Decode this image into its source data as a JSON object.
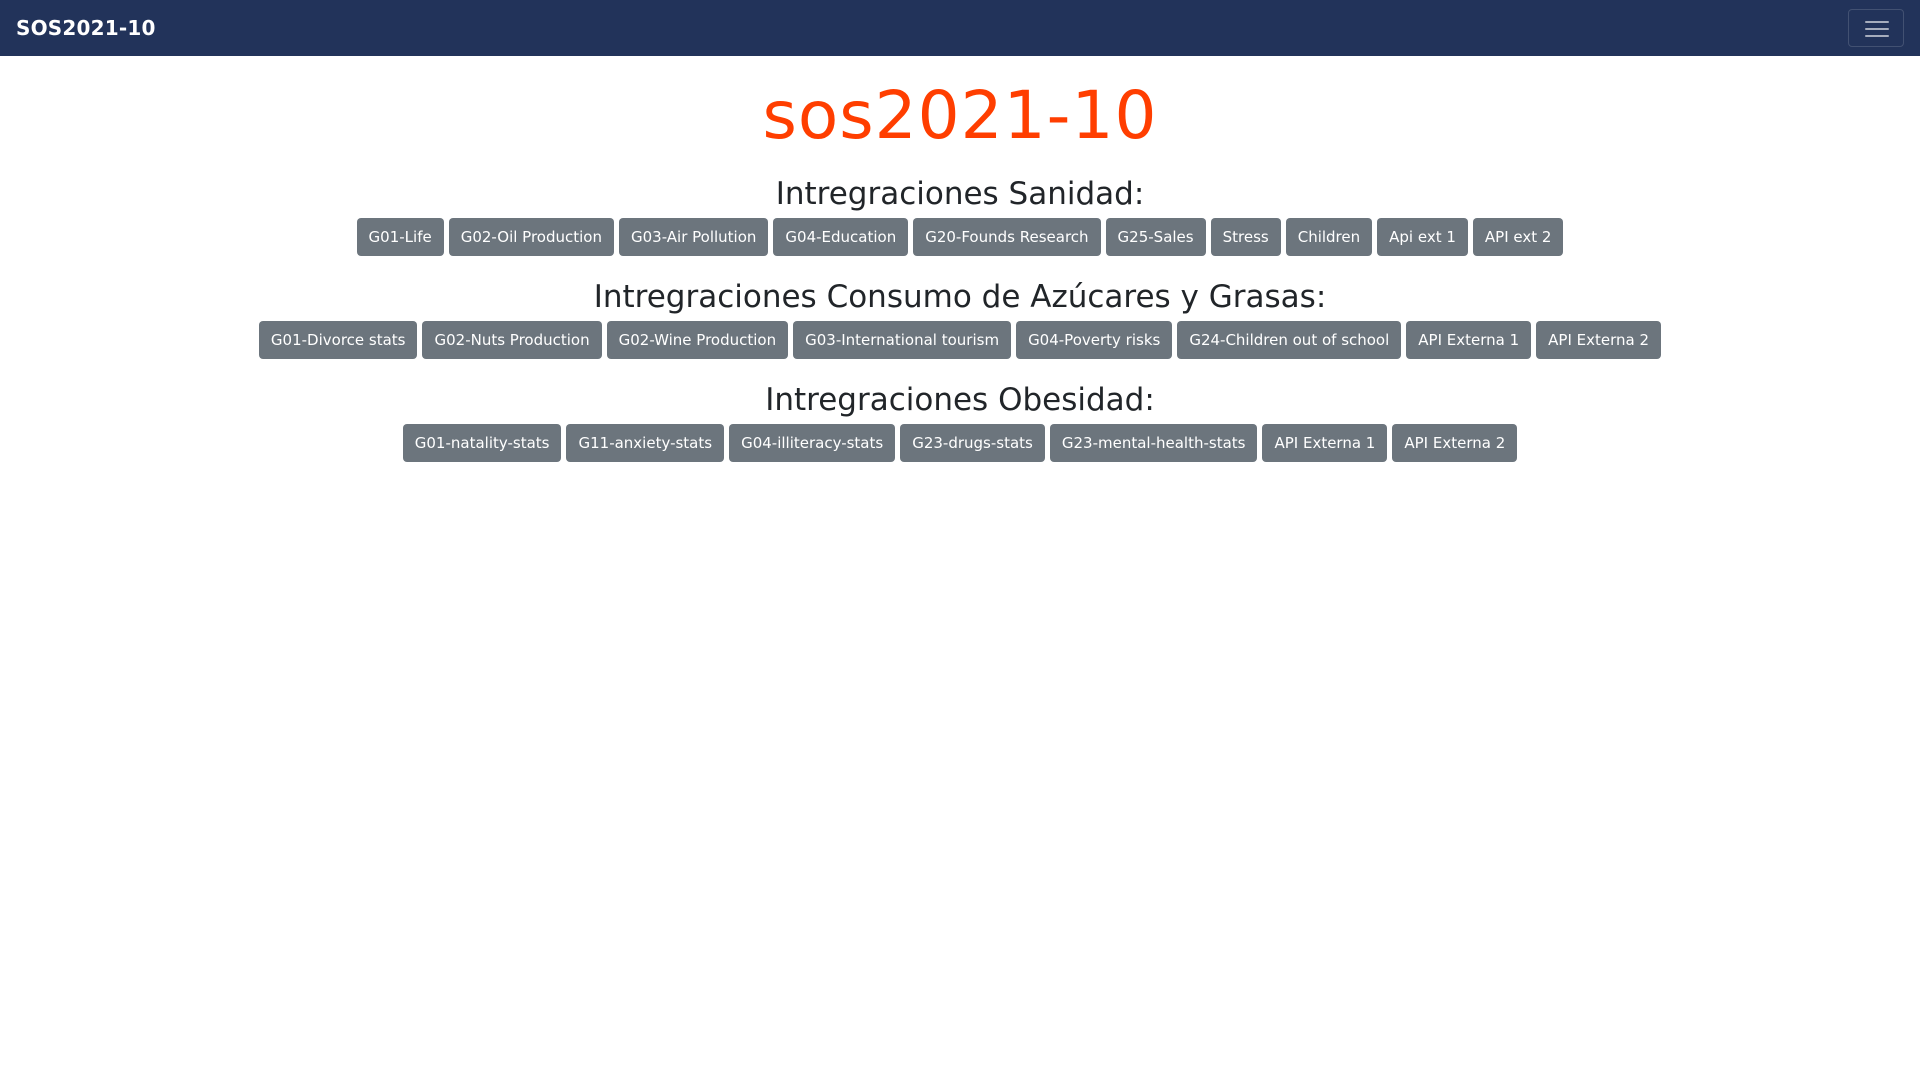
{
  "navbar": {
    "brand": "SOS2021-10",
    "colors": {
      "background": "#22335a",
      "text": "#ffffff"
    },
    "toggler_icon": "hamburger-menu-icon"
  },
  "main": {
    "title": "sos2021-10",
    "title_color": "#ff3e00",
    "sections": [
      {
        "title": "Intregraciones Sanidad:",
        "buttons": [
          "G01-Life",
          "G02-Oil Production",
          "G03-Air Pollution",
          "G04-Education",
          "G20-Founds Research",
          "G25-Sales",
          "Stress",
          "Children",
          "Api ext 1",
          "API ext 2"
        ]
      },
      {
        "title": "Intregraciones Consumo de Azúcares y Grasas:",
        "buttons": [
          "G01-Divorce stats",
          "G02-Nuts Production",
          "G02-Wine Production",
          "G03-International tourism",
          "G04-Poverty risks",
          "G24-Children out of school",
          "API Externa 1",
          "API Externa 2"
        ]
      },
      {
        "title": "Intregraciones Obesidad:",
        "buttons": [
          "G01-natality-stats",
          "G11-anxiety-stats",
          "G04-illiteracy-stats",
          "G23-drugs-stats",
          "G23-mental-health-stats",
          "API Externa 1",
          "API Externa 2"
        ]
      }
    ],
    "button_color": "#6c757d"
  }
}
